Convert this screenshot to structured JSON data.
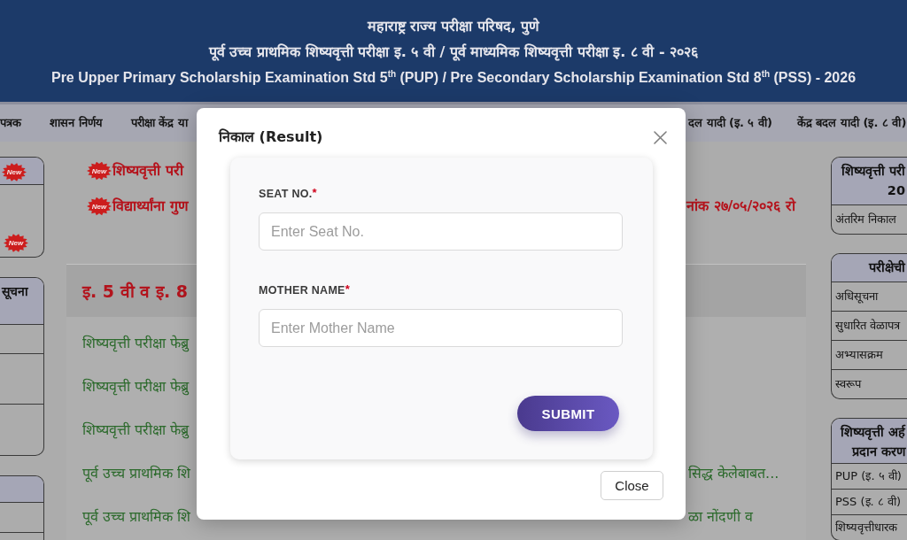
{
  "header": {
    "lines": [
      "महाराष्ट्र राज्य परीक्षा परिषद, पुणे",
      "पूर्व उच्च प्राथमिक शिष्यवृत्ती परीक्षा इ. ५ वी / पूर्व माध्यमिक शिष्यवृत्ती परीक्षा इ. ८ वी - २०२६",
      "Pre Upper Primary Scholarship Examination Std 5$^{th}$ (PUP) / Pre Secondary Scholarship Examination Std 8$^{th}$ (PSS) - 2026"
    ]
  },
  "nav": {
    "left_items": [
      "पत्रक",
      "शासन निर्णय",
      "परीक्षा केंद्र या"
    ],
    "right_items": [
      "दल यादी (इ. ५ वी)",
      "केंद्र बदल यादी (इ. ८ वी)"
    ]
  },
  "left_sidebar": [
    {
      "kind": "badges",
      "header_badge": "New",
      "body_badge": "New"
    },
    {
      "kind": "titled",
      "title": "सूचना"
    },
    {
      "kind": "plain"
    }
  ],
  "notices": [
    {
      "badge": "New",
      "text": "शिष्यवृत्ती परी"
    },
    {
      "badge": "New",
      "text": "विद्यार्थ्यांना गुण",
      "continued": "नांक २७/०५/२०२६ रो"
    }
  ],
  "section": {
    "title": "इ. 5 वी व इ. 8",
    "links": [
      {
        "text": "शिष्यवृत्ती परीक्षा फेब्रु"
      },
      {
        "text": "शिष्यवृत्ती परीक्षा फेब्रु"
      },
      {
        "text": "शिष्यवृत्ती परीक्षा फेब्रु"
      },
      {
        "text": "पूर्व उच्च प्राथमिक शि",
        "continued": "सिद्ध केलेबाबत..."
      },
      {
        "text": "पूर्व उच्च प्राथमिक शि",
        "continued": "ळा नोंदणी व"
      }
    ]
  },
  "right_sidebar": [
    {
      "title_lines": [
        "शिष्यवृत्ती परी",
        "20"
      ],
      "rows": [
        "अंतरिम निकाल"
      ]
    },
    {
      "title_lines": [
        "परीक्षेची"
      ],
      "rows": [
        "अधिसूचना",
        "सुधारित वेळापत्र",
        "अभ्यासक्रम",
        "स्वरूप"
      ]
    },
    {
      "title_lines": [
        "शिष्यवृत्ती अर्ह",
        "प्रदान करण"
      ],
      "rows": [
        "PUP (इ. ५ वी)",
        "PSS (इ. ८ वी)",
        "शिष्यवृत्तीधारक"
      ]
    }
  ],
  "modal": {
    "title": "निकाल (Result)",
    "fields": [
      {
        "label": "SEAT NO.",
        "required_mark": "*",
        "placeholder": "Enter Seat No."
      },
      {
        "label": "MOTHER NAME",
        "required_mark": "*",
        "placeholder": "Enter Mother Name"
      }
    ],
    "submit": "SUBMIT",
    "close": "Close"
  }
}
